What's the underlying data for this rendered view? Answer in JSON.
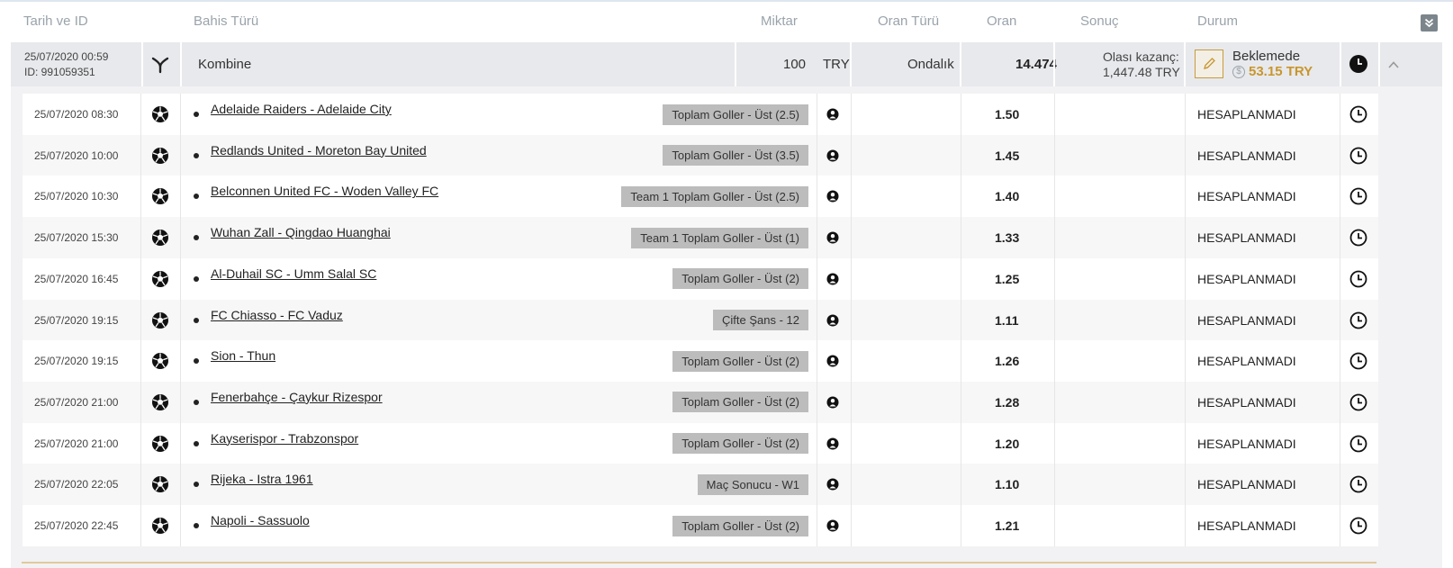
{
  "header": {
    "date_id": "Tarih ve ID",
    "bet_type": "Bahis Türü",
    "amount": "Miktar",
    "odds_type": "Oran Türü",
    "odds": "Oran",
    "result": "Sonuç",
    "status": "Durum"
  },
  "summary": {
    "date": "25/07/2020 00:59",
    "id": "ID: 991059351",
    "type": "Kombine",
    "amount": "100",
    "currency": "TRY",
    "odds_type": "Ondalık",
    "odds": "14.474",
    "potential_label": "Olası kazanç:",
    "potential_value": "1,447.48 TRY",
    "status": "Beklemede",
    "cashout": "53.15 TRY",
    "coin_symbol": "$"
  },
  "bets": [
    {
      "date": "25/07/2020 08:30",
      "match": "Adelaide Raiders - Adelaide City",
      "market": "Toplam Goller - Üst (2.5)",
      "odds": "1.50",
      "status": "HESAPLANMADI"
    },
    {
      "date": "25/07/2020 10:00",
      "match": "Redlands United - Moreton Bay United",
      "market": "Toplam Goller - Üst (3.5)",
      "odds": "1.45",
      "status": "HESAPLANMADI"
    },
    {
      "date": "25/07/2020 10:30",
      "match": "Belconnen United FC - Woden Valley FC",
      "market": "Team 1 Toplam Goller - Üst (2.5)",
      "odds": "1.40",
      "status": "HESAPLANMADI"
    },
    {
      "date": "25/07/2020 15:30",
      "match": "Wuhan Zall - Qingdao Huanghai",
      "market": "Team 1 Toplam Goller - Üst (1)",
      "odds": "1.33",
      "status": "HESAPLANMADI"
    },
    {
      "date": "25/07/2020 16:45",
      "match": "Al-Duhail SC - Umm Salal SC",
      "market": "Toplam Goller - Üst (2)",
      "odds": "1.25",
      "status": "HESAPLANMADI"
    },
    {
      "date": "25/07/2020 19:15",
      "match": "FC Chiasso - FC Vaduz",
      "market": "Çifte Şans - 12",
      "odds": "1.11",
      "status": "HESAPLANMADI"
    },
    {
      "date": "25/07/2020 19:15",
      "match": "Sion - Thun",
      "market": "Toplam Goller - Üst (2)",
      "odds": "1.26",
      "status": "HESAPLANMADI"
    },
    {
      "date": "25/07/2020 21:00",
      "match": "Fenerbahçe - Çaykur Rizespor",
      "market": "Toplam Goller - Üst (2)",
      "odds": "1.28",
      "status": "HESAPLANMADI"
    },
    {
      "date": "25/07/2020 21:00",
      "match": "Kayserispor - Trabzonspor",
      "market": "Toplam Goller - Üst (2)",
      "odds": "1.20",
      "status": "HESAPLANMADI"
    },
    {
      "date": "25/07/2020 22:05",
      "match": "Rijeka - Istra 1961",
      "market": "Maç Sonucu - W1",
      "odds": "1.10",
      "status": "HESAPLANMADI"
    },
    {
      "date": "25/07/2020 22:45",
      "match": "Napoli - Sassuolo",
      "market": "Toplam Goller - Üst (2)",
      "odds": "1.21",
      "status": "HESAPLANMADI"
    }
  ],
  "icons": {
    "combine": "combine-fork-icon",
    "sport": "football-icon",
    "person": "person-icon",
    "clock": "clock-icon",
    "edit": "pencil-icon",
    "collapse_all": "double-chevron-down-icon",
    "collapse_row": "chevron-up-icon"
  },
  "colors": {
    "accent_gold": "#c8962e",
    "summary_bg": "#e8e9ec",
    "tag_bg": "#bcbcbc"
  }
}
